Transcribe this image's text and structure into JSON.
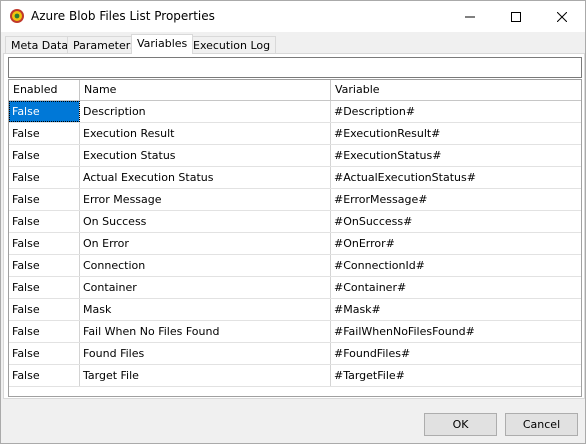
{
  "window": {
    "title": "Azure Blob Files List Properties",
    "icon": "gear-shield-icon"
  },
  "tabs": [
    {
      "label": "Meta Data",
      "active": false
    },
    {
      "label": "Parameters",
      "active": false
    },
    {
      "label": "Variables",
      "active": true
    },
    {
      "label": "Execution Log",
      "active": false
    }
  ],
  "filter": {
    "value": ""
  },
  "grid": {
    "headers": [
      "Enabled",
      "Name",
      "Variable"
    ],
    "rows": [
      {
        "enabled": "False",
        "name": "Description",
        "variable": "#Description#"
      },
      {
        "enabled": "False",
        "name": "Execution Result",
        "variable": "#ExecutionResult#"
      },
      {
        "enabled": "False",
        "name": "Execution Status",
        "variable": "#ExecutionStatus#"
      },
      {
        "enabled": "False",
        "name": "Actual Execution Status",
        "variable": "#ActualExecutionStatus#"
      },
      {
        "enabled": "False",
        "name": "Error Message",
        "variable": "#ErrorMessage#"
      },
      {
        "enabled": "False",
        "name": "On Success",
        "variable": "#OnSuccess#"
      },
      {
        "enabled": "False",
        "name": "On Error",
        "variable": "#OnError#"
      },
      {
        "enabled": "False",
        "name": "Connection",
        "variable": "#ConnectionId#"
      },
      {
        "enabled": "False",
        "name": "Container",
        "variable": "#Container#"
      },
      {
        "enabled": "False",
        "name": "Mask",
        "variable": "#Mask#"
      },
      {
        "enabled": "False",
        "name": "Fail When No Files Found",
        "variable": "#FailWhenNoFilesFound#"
      },
      {
        "enabled": "False",
        "name": "Found Files",
        "variable": "#FoundFiles#"
      },
      {
        "enabled": "False",
        "name": "Target File",
        "variable": "#TargetFile#"
      }
    ]
  },
  "buttons": {
    "ok": "OK",
    "cancel": "Cancel"
  },
  "colors": {
    "selection": "#0078d7"
  }
}
